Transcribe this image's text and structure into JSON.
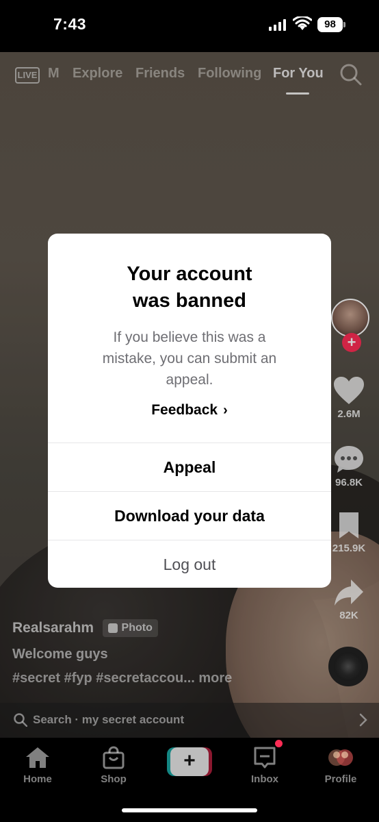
{
  "status": {
    "time": "7:43",
    "battery": "98"
  },
  "nav": {
    "live_label": "LIVE",
    "partial_tab": "M",
    "tabs": [
      "Explore",
      "Friends",
      "Following",
      "For You"
    ],
    "active_tab": "For You"
  },
  "rail": {
    "likes": "2.6M",
    "comments": "96.8K",
    "saves": "215.9K",
    "shares": "82K"
  },
  "post": {
    "username": "Realsarahm",
    "badge": "Photo",
    "caption": "Welcome guys",
    "hashtags": "#secret #fyp #secretaccou... more"
  },
  "search_bar": {
    "text": "Search · my secret account"
  },
  "modal": {
    "title_line1": "Your account",
    "title_line2": "was banned",
    "message_line1": "If you believe this was a",
    "message_line2": "mistake, you can submit an",
    "message_line3": "appeal.",
    "feedback": "Feedback",
    "appeal": "Appeal",
    "download": "Download your data",
    "logout": "Log out"
  },
  "tab_bar": {
    "home": "Home",
    "shop": "Shop",
    "create": "+",
    "inbox": "Inbox",
    "profile": "Profile"
  },
  "colors": {
    "accent_red": "#fe2c55",
    "accent_cyan": "#25f4ee",
    "modal_bg": "#ffffff"
  }
}
